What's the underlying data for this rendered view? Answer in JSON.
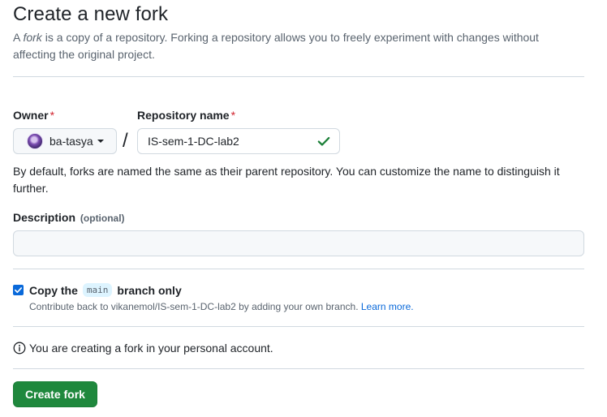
{
  "header": {
    "title": "Create a new fork",
    "subtitle_prefix": "A ",
    "subtitle_em": "fork",
    "subtitle_rest": " is a copy of a repository. Forking a repository allows you to freely experiment with changes without affecting the original project."
  },
  "owner": {
    "label": "Owner",
    "required_mark": "*",
    "value": "ba-tasya",
    "icon": "avatar"
  },
  "separator": "/",
  "repository": {
    "label": "Repository name",
    "required_mark": "*",
    "value": "IS-sem-1-DC-lab2",
    "valid_icon": "check-icon",
    "valid_color": "#1a7f37"
  },
  "naming_help": "By default, forks are named the same as their parent repository. You can customize the name to distinguish it further.",
  "description": {
    "label": "Description",
    "optional_label": "(optional)",
    "value": ""
  },
  "copy_branch": {
    "checked": true,
    "label_before": "Copy the",
    "branch": "main",
    "label_after": "branch only",
    "note": "Contribute back to vikanemol/IS-sem-1-DC-lab2 by adding your own branch.",
    "learn_more": "Learn more."
  },
  "info": {
    "icon": "info-icon",
    "text": "You are creating a fork in your personal account."
  },
  "actions": {
    "create_label": "Create fork",
    "create_color": "#1f883d"
  },
  "colors": {
    "accent": "#0969da",
    "required": "#d1242f",
    "muted": "#59636e",
    "border": "#d1d9e0"
  }
}
